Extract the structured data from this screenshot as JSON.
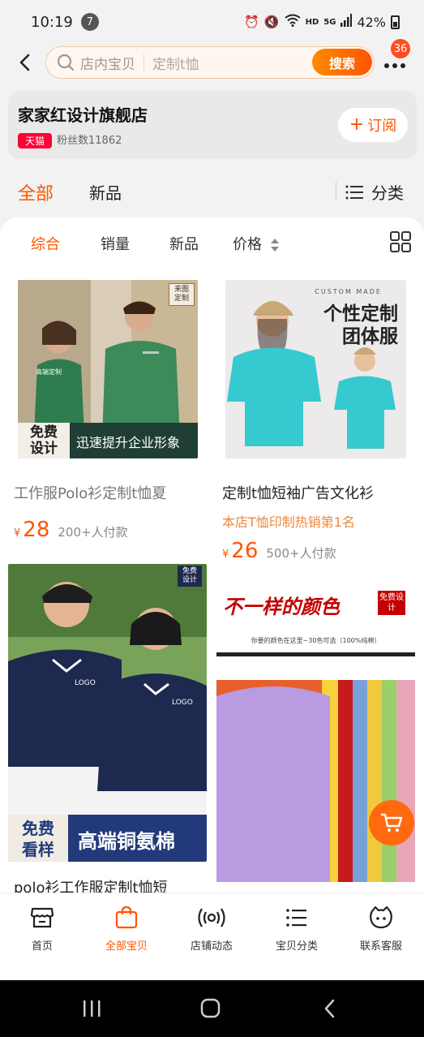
{
  "status": {
    "time": "10:19",
    "notif_count": "7",
    "network_hd": "HD",
    "network_5g": "5G",
    "battery": "42%"
  },
  "search": {
    "scope": "店内宝贝",
    "query": "定制t恤",
    "button": "搜索",
    "more_badge": "36"
  },
  "shop": {
    "name": "家家红设计旗舰店",
    "badge": "天猫",
    "fans": "粉丝数11862",
    "subscribe": "订阅"
  },
  "top_tabs": {
    "all": "全部",
    "new": "新品",
    "category": "分类"
  },
  "sort": {
    "comprehensive": "综合",
    "sales": "销量",
    "new": "新品",
    "price": "价格"
  },
  "products": [
    {
      "title": "工作服Polo衫定制t恤夏",
      "price": "28",
      "sales": "200+人付款",
      "img_corner": "来图定制",
      "img_tag1": "免费设计",
      "img_tag2": "迅速提升企业形象",
      "logo_text": "高端定制"
    },
    {
      "title": "定制t恤短袖广告文化衫",
      "promo": "本店T恤印制热销第1名",
      "price": "26",
      "sales": "500+人付款",
      "img_caption_en": "CUSTOM MADE",
      "img_headline1": "个性定制",
      "img_headline2": "团体服"
    },
    {
      "title": "polo衫工作服定制t恤短",
      "img_corner": "免费设计",
      "img_tag1": "免费看样",
      "img_tag2": "高端铜氨棉",
      "logo_text": "LOGO"
    },
    {
      "img_headline": "不一样的颜色",
      "img_corner": "免费设计",
      "img_subtext": "你要的颜色在这里~30色可选（100%纯棉）"
    }
  ],
  "currency": "¥",
  "bottom_nav": [
    {
      "label": "首页"
    },
    {
      "label": "全部宝贝"
    },
    {
      "label": "店铺动态"
    },
    {
      "label": "宝贝分类"
    },
    {
      "label": "联系客服"
    }
  ],
  "colors": {
    "accent": "#ff5500",
    "tmall": "#ff0036"
  }
}
